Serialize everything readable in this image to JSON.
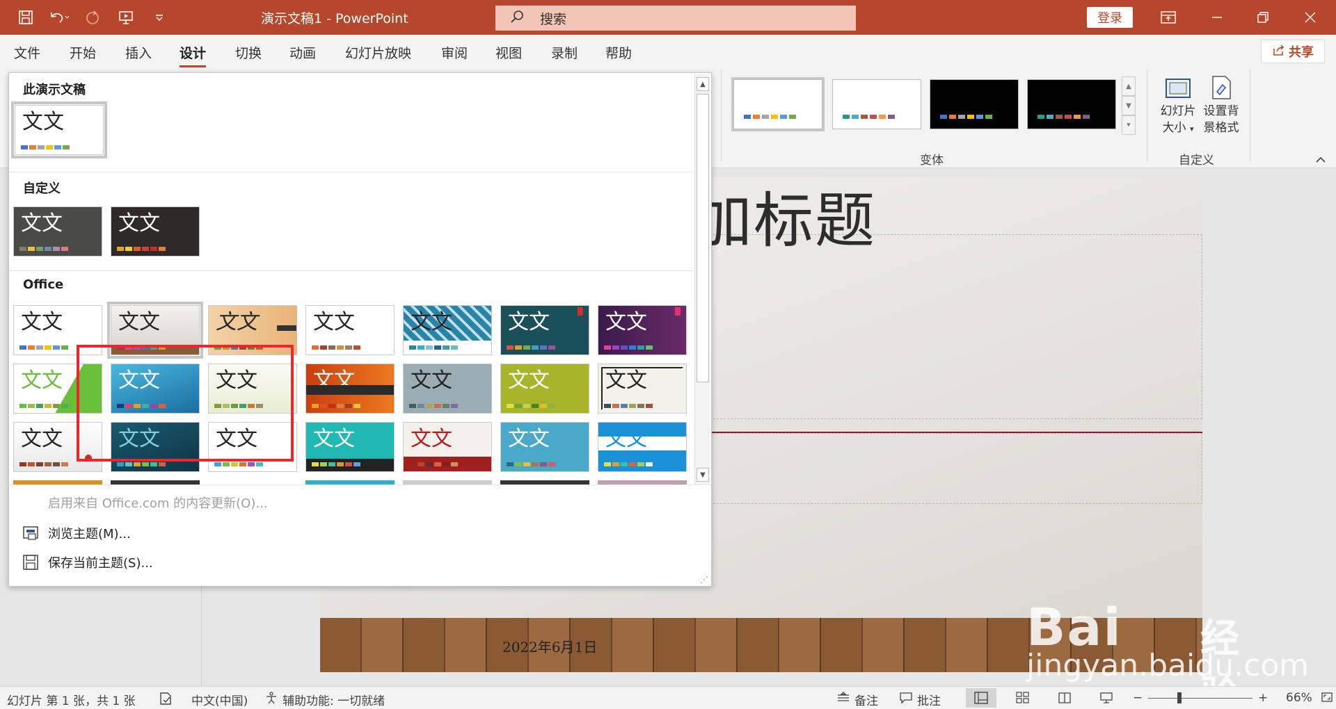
{
  "titlebar": {
    "doc_title": "演示文稿1  -  PowerPoint",
    "search_placeholder": "搜索",
    "login_label": "登录",
    "bg_color": "#b7472a"
  },
  "tabs": [
    {
      "label": "文件"
    },
    {
      "label": "开始"
    },
    {
      "label": "插入"
    },
    {
      "label": "设计",
      "active": true
    },
    {
      "label": "切换"
    },
    {
      "label": "动画"
    },
    {
      "label": "幻灯片放映"
    },
    {
      "label": "审阅"
    },
    {
      "label": "视图"
    },
    {
      "label": "录制"
    },
    {
      "label": "帮助"
    }
  ],
  "share_label": "共享",
  "ribbon": {
    "variants_group": "变体",
    "custom_group": "自定义",
    "slide_size_line1": "幻灯片",
    "slide_size_line2": "大小",
    "bg_format_line1": "设置背",
    "bg_format_line2": "景格式"
  },
  "gallery": {
    "section_this": "此演示文稿",
    "section_custom": "自定义",
    "section_office": "Office",
    "thumb_text": "文文",
    "menu_update": "启用来自 Office.com 的内容更新(O)...",
    "menu_browse": "浏览主题(M)...",
    "menu_save": "保存当前主题(S)..."
  },
  "slide": {
    "title": "单击此处添加标题",
    "date": "2022年6月1日"
  },
  "watermark": {
    "brand": "Bai",
    "brand_cn": "经验",
    "url": "jingyan.baidu.com"
  },
  "statusbar": {
    "slide_info": "幻灯片 第 1 张，共 1 张",
    "language": "中文(中国)",
    "accessibility": "辅助功能: 一切就绪",
    "notes": "备注",
    "comments": "批注",
    "zoom": "66%"
  }
}
